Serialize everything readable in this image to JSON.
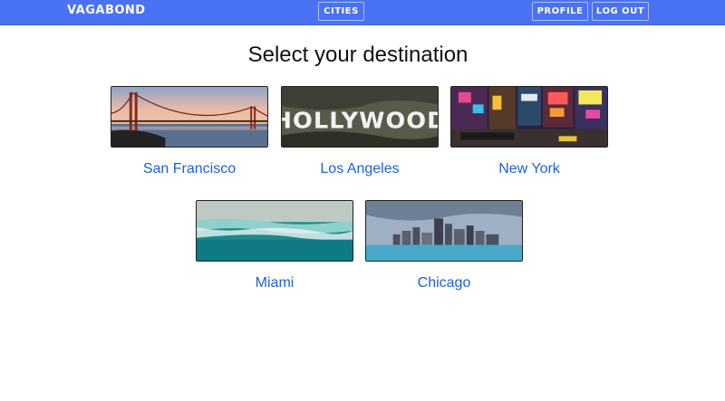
{
  "nav": {
    "brand": "VAGABOND",
    "cities_label": "CITIES",
    "profile_label": "PROFILE",
    "logout_label": "LOG OUT",
    "background": "#4a72f5"
  },
  "main": {
    "title": "Select your destination",
    "cities": [
      {
        "name": "San Francisco",
        "image": "golden-gate-bridge"
      },
      {
        "name": "Los Angeles",
        "image": "hollywood-sign"
      },
      {
        "name": "New York",
        "image": "times-square"
      },
      {
        "name": "Miami",
        "image": "ocean-shoreline"
      },
      {
        "name": "Chicago",
        "image": "skyline-waterfront"
      }
    ],
    "link_color": "#1f5fd6"
  }
}
